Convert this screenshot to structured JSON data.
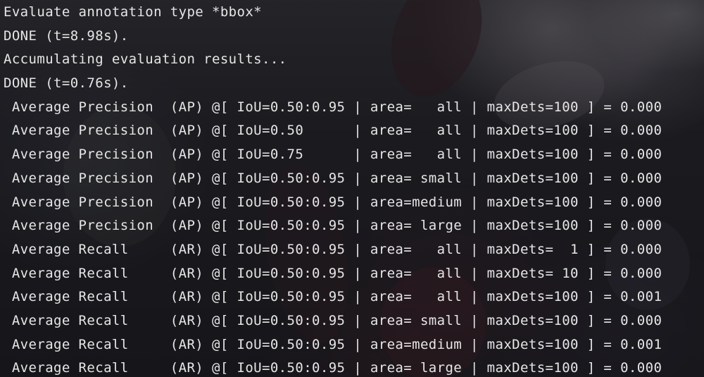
{
  "terminal": {
    "lines": [
      "Evaluate annotation type *bbox*",
      "DONE (t=8.98s).",
      "Accumulating evaluation results...",
      "DONE (t=0.76s).",
      " Average Precision  (AP) @[ IoU=0.50:0.95 | area=   all | maxDets=100 ] = 0.000",
      " Average Precision  (AP) @[ IoU=0.50      | area=   all | maxDets=100 ] = 0.000",
      " Average Precision  (AP) @[ IoU=0.75      | area=   all | maxDets=100 ] = 0.000",
      " Average Precision  (AP) @[ IoU=0.50:0.95 | area= small | maxDets=100 ] = 0.000",
      " Average Precision  (AP) @[ IoU=0.50:0.95 | area=medium | maxDets=100 ] = 0.000",
      " Average Precision  (AP) @[ IoU=0.50:0.95 | area= large | maxDets=100 ] = 0.000",
      " Average Recall     (AR) @[ IoU=0.50:0.95 | area=   all | maxDets=  1 ] = 0.000",
      " Average Recall     (AR) @[ IoU=0.50:0.95 | area=   all | maxDets= 10 ] = 0.000",
      " Average Recall     (AR) @[ IoU=0.50:0.95 | area=   all | maxDets=100 ] = 0.001",
      " Average Recall     (AR) @[ IoU=0.50:0.95 | area= small | maxDets=100 ] = 0.000",
      " Average Recall     (AR) @[ IoU=0.50:0.95 | area=medium | maxDets=100 ] = 0.001",
      " Average Recall     (AR) @[ IoU=0.50:0.95 | area= large | maxDets=100 ] = 0.000"
    ]
  },
  "colors": {
    "text": "#e6e6e6",
    "background": "#1f1f23"
  }
}
